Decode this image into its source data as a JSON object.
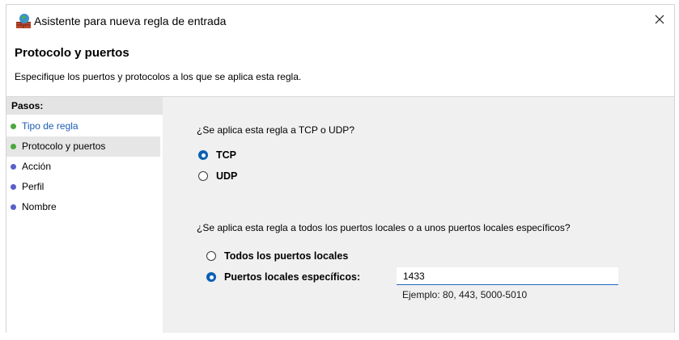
{
  "window": {
    "title": "Asistente para nueva regla de entrada",
    "close_glyph": "✕",
    "icon": "firewall-icon"
  },
  "header": {
    "title": "Protocolo y puertos",
    "description": "Especifique los puertos y protocolos a los que se aplica esta regla."
  },
  "sidebar": {
    "heading": "Pasos:",
    "steps": [
      {
        "label": "Tipo de regla",
        "state": "done",
        "color": "#4aa73c"
      },
      {
        "label": "Protocolo y puertos",
        "state": "current",
        "color": "#4aa73c"
      },
      {
        "label": "Acción",
        "state": "pending",
        "color": "#5a5fc9"
      },
      {
        "label": "Perfil",
        "state": "pending",
        "color": "#5a5fc9"
      },
      {
        "label": "Nombre",
        "state": "pending",
        "color": "#5a5fc9"
      }
    ]
  },
  "protocol": {
    "question": "¿Se aplica esta regla a TCP o UDP?",
    "options": [
      {
        "label": "TCP",
        "checked": true
      },
      {
        "label": "UDP",
        "checked": false
      }
    ]
  },
  "ports": {
    "question": "¿Se aplica esta regla a todos los puertos locales o a unos puertos locales específicos?",
    "options": [
      {
        "label": "Todos los puertos locales",
        "checked": false
      },
      {
        "label": "Puertos locales específicos:",
        "checked": true
      }
    ],
    "value": "1433",
    "example": "Ejemplo: 80, 443, 5000-5010"
  },
  "colors": {
    "accent": "#0a5fb4",
    "link": "#1a5db5",
    "content_bg": "#f0f0f0"
  }
}
